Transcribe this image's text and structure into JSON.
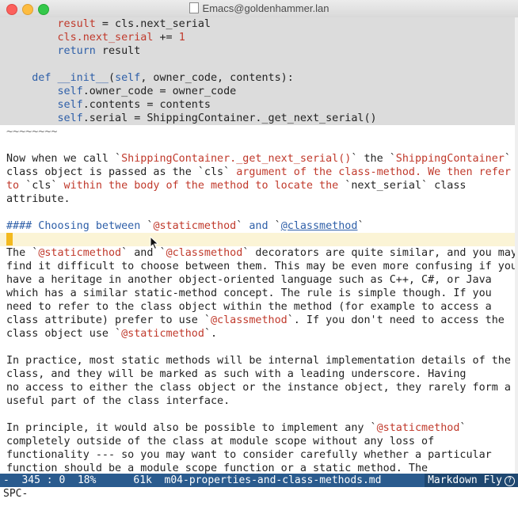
{
  "window": {
    "title": "Emacs@goldenhammer.lan"
  },
  "code_lines": [
    "        result = cls.next_serial",
    "        cls.next_serial += 1",
    "        return result",
    "",
    "    def __init__(self, owner_code, contents):",
    "        self.owner_code = owner_code",
    "        self.contents = contents",
    "        self.serial = ShippingContainer._get_next_serial()"
  ],
  "fence_line": "~~~~~~~~",
  "paragraph1": [
    "Now when we call `ShippingContainer._get_next_serial()` the `ShippingContainer`",
    "class object is passed as the `cls` argument of the class-method. We then refer",
    "to `cls` within the body of the method to locate the `next_serial` class",
    "attribute."
  ],
  "heading": "#### Choosing between `@staticmethod` and `@classmethod`",
  "paragraph2": [
    "The `@staticmethod` and `@classmethod` decorators are quite similar, and you may",
    "find it difficult to choose between them. This may be even more confusing if you",
    "have a heritage in another object-oriented language such as C++, C#, or Java",
    "which has a similar static-method concept. The rule is simple though. If you",
    "need to refer to the class object within the method (for example to access a",
    "class attribute) prefer to use `@classmethod`. If you don't need to access the",
    "class object use `@staticmethod`."
  ],
  "paragraph3": [
    "In practice, most static methods will be internal implementation details of the",
    "class, and they will be marked as such with a leading underscore. Having",
    "no access to either the class object or the instance object, they rarely form a",
    "useful part of the class interface."
  ],
  "paragraph4": [
    "In principle, it would also be possible to implement any `@staticmethod`",
    "completely outside of the class at module scope without any loss of",
    "functionality --- so you may want to consider carefully whether a particular",
    "function should be a module scope function or a static method. The"
  ],
  "modeline": {
    "state": "-",
    "line": "345",
    "col": "0",
    "percent": "18%",
    "size": "61k",
    "buffer": "m04-properties-and-class-methods.md",
    "mode": "Markdown Fly",
    "icon": "circled-question-icon"
  },
  "minibuffer": "SPC-"
}
